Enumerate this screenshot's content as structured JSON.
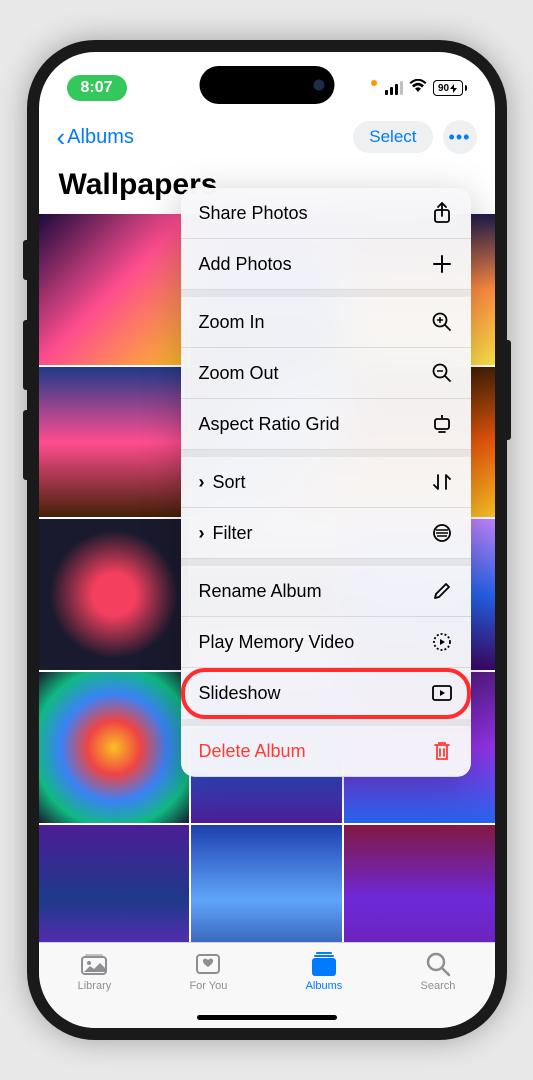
{
  "status": {
    "time": "8:07",
    "battery": "90"
  },
  "nav": {
    "back_label": "Albums",
    "select_label": "Select"
  },
  "album": {
    "title": "Wallpapers"
  },
  "menu": {
    "share": "Share Photos",
    "add": "Add Photos",
    "zoom_in": "Zoom In",
    "zoom_out": "Zoom Out",
    "aspect": "Aspect Ratio Grid",
    "sort": "Sort",
    "filter": "Filter",
    "rename": "Rename Album",
    "play_memory": "Play Memory Video",
    "slideshow": "Slideshow",
    "delete": "Delete Album"
  },
  "tabs": {
    "library": "Library",
    "for_you": "For You",
    "albums": "Albums",
    "search": "Search"
  }
}
